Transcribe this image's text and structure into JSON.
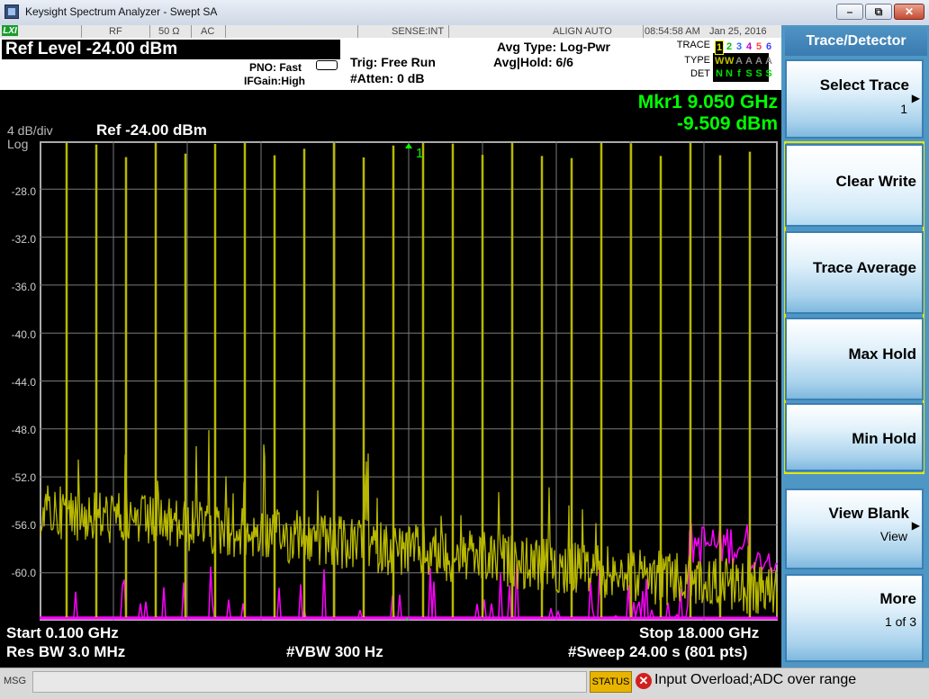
{
  "window": {
    "title": "Keysight Spectrum Analyzer - Swept SA",
    "min_glyph": "–",
    "max_glyph": "⧉",
    "close_glyph": "✕"
  },
  "status_band": {
    "lxi": "LXI",
    "rf": "RF",
    "impedance": "50 Ω",
    "coupling": "AC",
    "sense": "SENSE:INT",
    "align": "ALIGN AUTO",
    "time": "08:54:58 AM",
    "date": "Jan 25, 2016"
  },
  "header": {
    "ref_level": "Ref Level -24.00 dBm",
    "pno": "PNO: Fast",
    "ifgain": "IFGain:High",
    "trig": "Trig: Free Run",
    "atten": "#Atten: 0 dB",
    "avg_type": "Avg Type: Log-Pwr",
    "avg_hold": "Avg|Hold: 6/6",
    "trace_label": "TRACE",
    "type_label": "TYPE",
    "det_label": "DET",
    "trace_nums": [
      "1",
      "2",
      "3",
      "4",
      "5",
      "6"
    ],
    "trace_colors": [
      "#f0f000",
      "#00c000",
      "#3060ff",
      "#c000c0",
      "#ff4040",
      "#4040ff"
    ],
    "type_row": [
      "W",
      "W",
      "A",
      "A",
      "A",
      "A"
    ],
    "det_row": [
      "N",
      "N",
      "f",
      "S",
      "S",
      "S"
    ]
  },
  "display": {
    "scale": "4 dB/div",
    "log": "Log",
    "ref": "Ref -24.00 dBm",
    "marker_freq": "Mkr1 9.050 GHz",
    "marker_amp": "-9.509 dBm",
    "marker_label": "1",
    "y_ticks": [
      "-28.0",
      "-32.0",
      "-36.0",
      "-40.0",
      "-44.0",
      "-48.0",
      "-52.0",
      "-56.0",
      "-60.0"
    ],
    "start": "Start 0.100 GHz",
    "res_bw": "Res BW 3.0 MHz",
    "vbw": "#VBW 300 Hz",
    "stop": "Stop 18.000 GHz",
    "sweep": "#Sweep  24.00 s (801 pts)",
    "colors": {
      "trace1": "#b8b800",
      "trace2": "#ff00ff",
      "marker": "#00ff00",
      "grid": "#7a7a7a"
    }
  },
  "softkeys": {
    "title": "Trace/Detector",
    "select_trace": "Select Trace",
    "select_trace_value": "1",
    "clear_write": "Clear Write",
    "trace_average": "Trace Average",
    "max_hold": "Max Hold",
    "min_hold": "Min Hold",
    "view_blank": "View Blank",
    "view_blank_value": "View",
    "more": "More",
    "more_value": "1 of 3",
    "arrow": "▶"
  },
  "msgbar": {
    "label": "MSG",
    "status": "STATUS",
    "error_glyph": "✕",
    "message": "Input Overload;ADC over range"
  }
}
